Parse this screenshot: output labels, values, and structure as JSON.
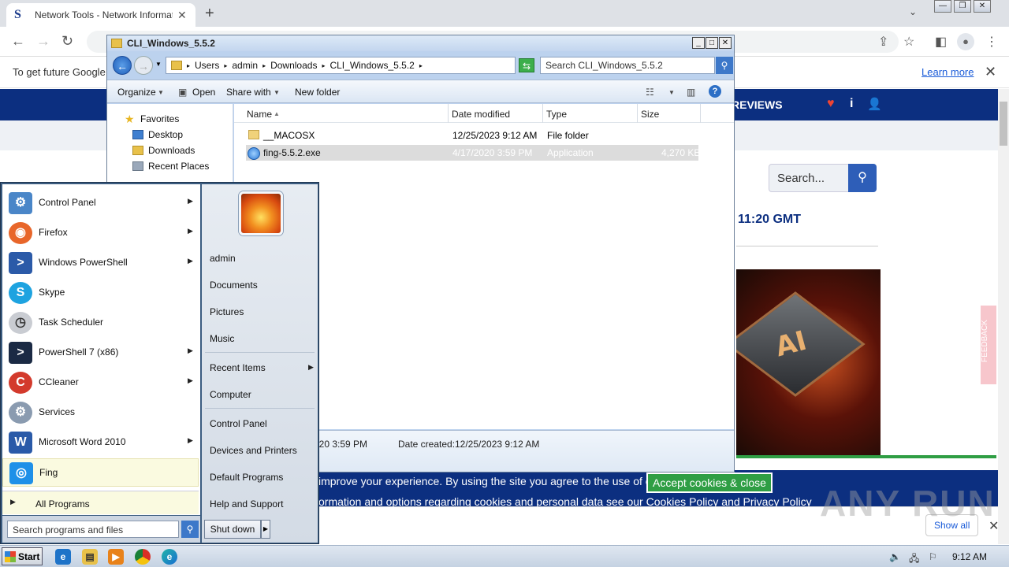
{
  "browser": {
    "tab_title": "Network Tools - Network Information",
    "favicon_letter": "S",
    "infobar_text": "To get future Google",
    "learn_more": "Learn more"
  },
  "site": {
    "nav_reviews": "REVIEWS",
    "search_placeholder": "Search...",
    "time_text": "11:20 GMT",
    "hero_chip_label": "AI",
    "cookie_line1": "improve your experience. By using the site you agree to the use of cookies.",
    "cookie_accept": "Accept cookies & close",
    "cookie_line2": "ormation and options regarding cookies and personal data see our Cookies Policy and Privacy Policy",
    "feedback": "FEEDBACK",
    "show_all": "Show all",
    "watermark": "ANY RUN"
  },
  "explorer": {
    "title": "CLI_Windows_5.5.2",
    "breadcrumb": [
      "Users",
      "admin",
      "Downloads",
      "CLI_Windows_5.5.2"
    ],
    "search_placeholder": "Search CLI_Windows_5.5.2",
    "commands": {
      "organize": "Organize",
      "open": "Open",
      "share_with": "Share with",
      "new_folder": "New folder"
    },
    "nav": {
      "favorites": "Favorites",
      "desktop": "Desktop",
      "downloads": "Downloads",
      "recent_places": "Recent Places"
    },
    "columns": [
      "Name",
      "Date modified",
      "Type",
      "Size"
    ],
    "files": [
      {
        "name": "__MACOSX",
        "date": "12/25/2023 9:12 AM",
        "type": "File folder",
        "size": ""
      },
      {
        "name": "fing-5.5.2.exe",
        "date": "4/17/2020 3:59 PM",
        "type": "Application",
        "size": "4,270 KB"
      }
    ],
    "details": {
      "modified_fragment": "020 3:59 PM",
      "created_label": "Date created:",
      "created_value": "12/25/2023 9:12 AM",
      "extra_fragment": "3"
    }
  },
  "start_menu": {
    "programs": [
      {
        "label": "Control Panel",
        "icon": "control-panel-icon",
        "color": "#4a86c8",
        "arrow": true
      },
      {
        "label": "Firefox",
        "icon": "firefox-icon",
        "color": "#e8662a",
        "arrow": true
      },
      {
        "label": "Windows PowerShell",
        "icon": "powershell-icon",
        "color": "#2b5aa8",
        "arrow": true
      },
      {
        "label": "Skype",
        "icon": "skype-icon",
        "color": "#1ea3e0",
        "arrow": false
      },
      {
        "label": "Task Scheduler",
        "icon": "task-scheduler-icon",
        "color": "#c9ccd2",
        "arrow": false
      },
      {
        "label": "PowerShell 7 (x86)",
        "icon": "powershell7-icon",
        "color": "#1b2a44",
        "arrow": true
      },
      {
        "label": "CCleaner",
        "icon": "ccleaner-icon",
        "color": "#d33a2c",
        "arrow": true
      },
      {
        "label": "Services",
        "icon": "services-icon",
        "color": "#8a9bb0",
        "arrow": false
      },
      {
        "label": "Microsoft Word 2010",
        "icon": "word-icon",
        "color": "#2a5aa8",
        "arrow": true
      },
      {
        "label": "Fing",
        "icon": "fing-icon",
        "color": "#1e90e8",
        "arrow": false
      }
    ],
    "all_programs": "All Programs",
    "search_placeholder": "Search programs and files",
    "right_items": {
      "admin": "admin",
      "documents": "Documents",
      "pictures": "Pictures",
      "music": "Music",
      "recent_items": "Recent Items",
      "computer": "Computer",
      "control_panel": "Control Panel",
      "devices_printers": "Devices and Printers",
      "default_programs": "Default Programs",
      "help_support": "Help and Support"
    },
    "shutdown": "Shut down"
  },
  "taskbar": {
    "start": "Start",
    "clock": "9:12 AM"
  }
}
